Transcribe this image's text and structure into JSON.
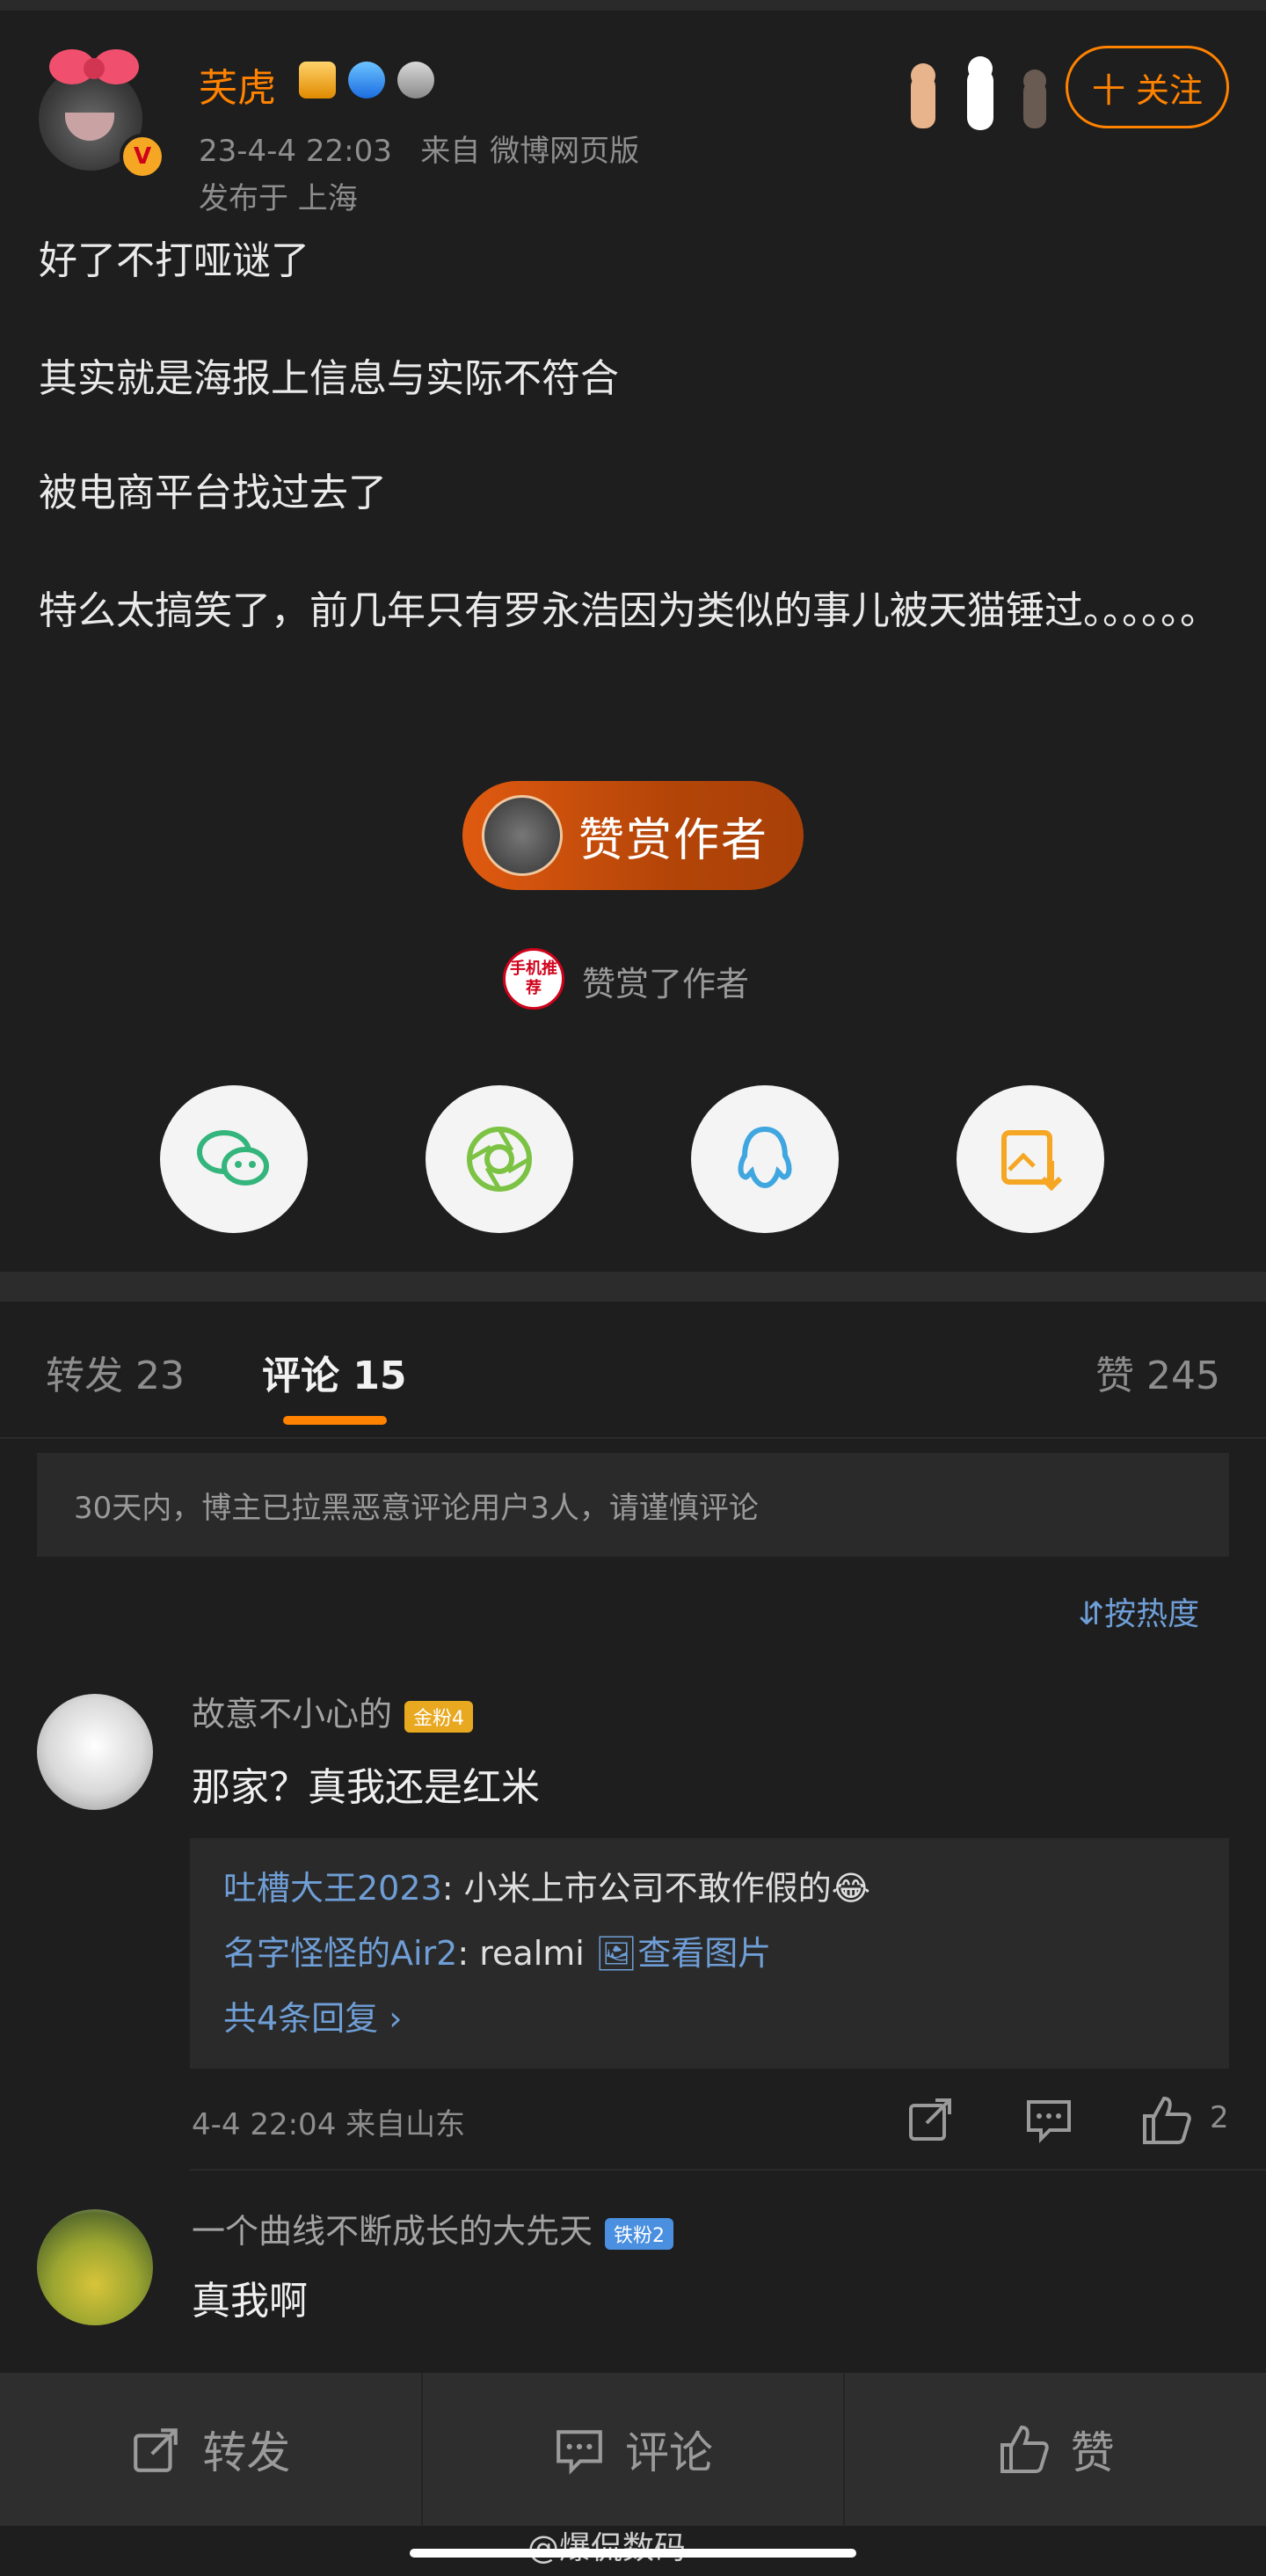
{
  "post": {
    "author": {
      "name": "芺虎",
      "badges": [
        "crown-badge-icon",
        "diamond-badge-icon",
        "medal-badge-icon"
      ],
      "verified": true
    },
    "time": "23-4-4 22:03",
    "source": "来自 微博网页版",
    "location": "发布于 上海",
    "follow_label": "十 关注",
    "paragraphs": [
      "好了不打哑谜了",
      "其实就是海报上信息与实际不符合",
      "被电商平台找过去了",
      "特么太搞笑了，前几年只有罗永浩因为类似的事儿被天猫锤过。。。。。。"
    ],
    "reward_label": "赞赏作者",
    "rewarded_stamp": "手机推荐",
    "rewarded_text": "赞赏了作者",
    "share": [
      "wechat-icon",
      "moments-icon",
      "qq-icon",
      "save-image-icon"
    ]
  },
  "tabs": {
    "repost": "转发 23",
    "comment": "评论 15",
    "like": "赞 245"
  },
  "notice": "30天内，博主已拉黑恶意评论用户3人，请谨慎评论",
  "sort_label": "按热度",
  "comments": [
    {
      "user": "故意不小心的",
      "fan_badge": "金粉4",
      "text": "那家？真我还是红米",
      "replies": [
        {
          "user": "吐槽大王2023",
          "text": "小米上市公司不敢作假的😂"
        },
        {
          "user": "名字怪怪的Air2",
          "text": "realmi",
          "link": "查看图片"
        }
      ],
      "more_replies": "共4条回复",
      "time_loc": "4-4 22:04  来自山东",
      "likes": "2"
    },
    {
      "user": "一个曲线不断成长的大先天",
      "fan_badge": "铁粉2",
      "text": "真我啊"
    }
  ],
  "bottom_bar": {
    "repost": "转发",
    "comment": "评论",
    "like": "赞"
  },
  "watermark": "@爆侃数码",
  "colors": {
    "accent": "#ff8200",
    "link": "#6f9ed6",
    "background": "#1e1e1e"
  }
}
